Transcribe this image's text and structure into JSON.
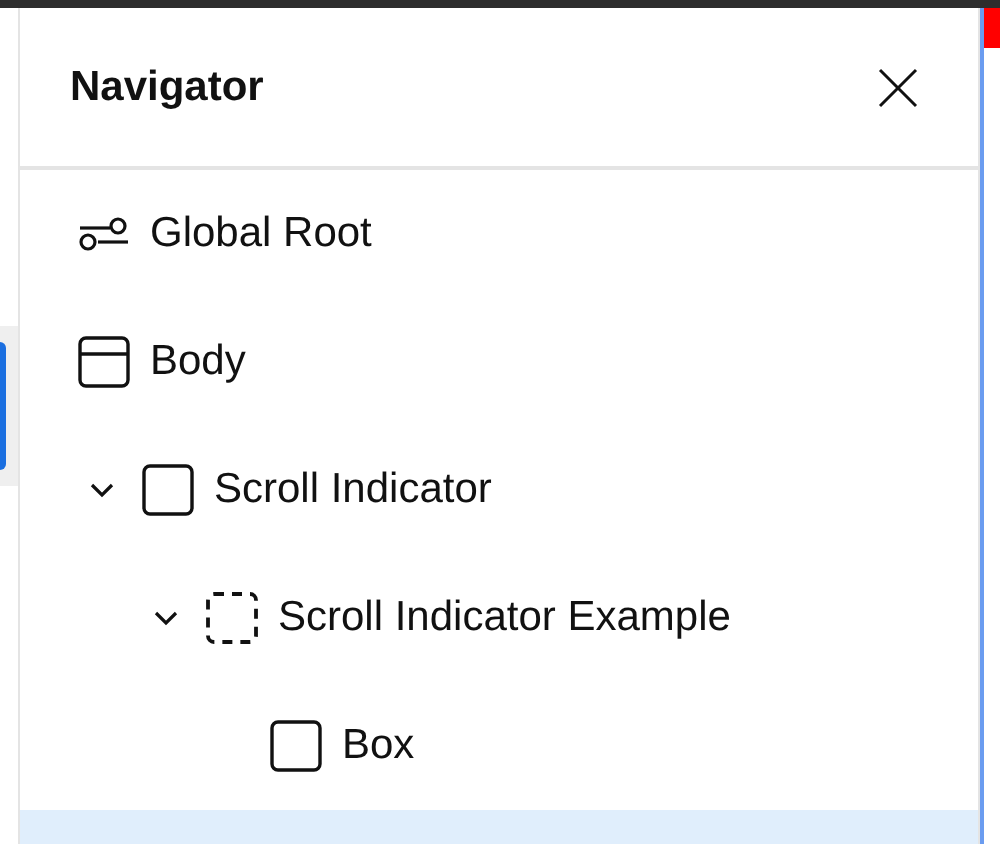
{
  "navigator": {
    "title": "Navigator",
    "tree": [
      {
        "label": "Global Root",
        "kind": "global",
        "selected": false
      },
      {
        "label": "Body",
        "kind": "body",
        "selected": false,
        "children": [
          {
            "label": "Scroll Indicator",
            "kind": "box",
            "selected": false,
            "expanded": true,
            "children": [
              {
                "label": "Scroll Indicator Example",
                "kind": "slot",
                "selected": false,
                "expanded": true,
                "children": [
                  {
                    "label": "Box",
                    "kind": "box",
                    "selected": false
                  }
                ]
              }
            ]
          }
        ]
      },
      {
        "selected": true
      }
    ]
  }
}
